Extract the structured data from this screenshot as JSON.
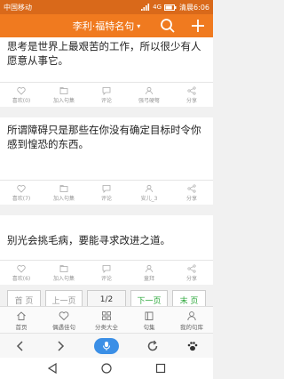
{
  "status": {
    "carrier": "中国移动",
    "time": "清晨6:06",
    "network": "4G",
    "battery_level": 0.8
  },
  "appbar": {
    "title": "李利·福特名句",
    "caret": "▾"
  },
  "quotes": [
    {
      "text": "思考是世界上最艰苦的工作，所以很少有人愿意从事它。",
      "likes": "喜欢(0)",
      "fav": "加入句集",
      "comment": "评论",
      "author": "强弓硬弩",
      "share": "分享"
    },
    {
      "text": "所谓障碍只是那些在你没有确定目标时令你感到惶恐的东西。",
      "likes": "喜欢(7)",
      "fav": "加入句集",
      "comment": "评论",
      "author": "安儿_3",
      "share": "分享"
    },
    {
      "text": "别光会挑毛病，要能寻求改进之道。",
      "likes": "喜欢(6)",
      "fav": "加入句集",
      "comment": "评论",
      "author": "童拜",
      "share": "分享"
    }
  ],
  "pager": {
    "first": "首 页",
    "prev": "上一页",
    "current": "1/2",
    "next": "下一页",
    "last": "末 页"
  },
  "tabs": [
    {
      "label": "首页",
      "icon": "home-icon"
    },
    {
      "label": "偶遇佳句",
      "icon": "heart-icon"
    },
    {
      "label": "分类大全",
      "icon": "grid-icon"
    },
    {
      "label": "句集",
      "icon": "book-icon"
    },
    {
      "label": "我的句库",
      "icon": "person-icon"
    }
  ],
  "colors": {
    "accent": "#f07a1f",
    "green": "#2ea83c",
    "mic": "#3b8fe6"
  }
}
